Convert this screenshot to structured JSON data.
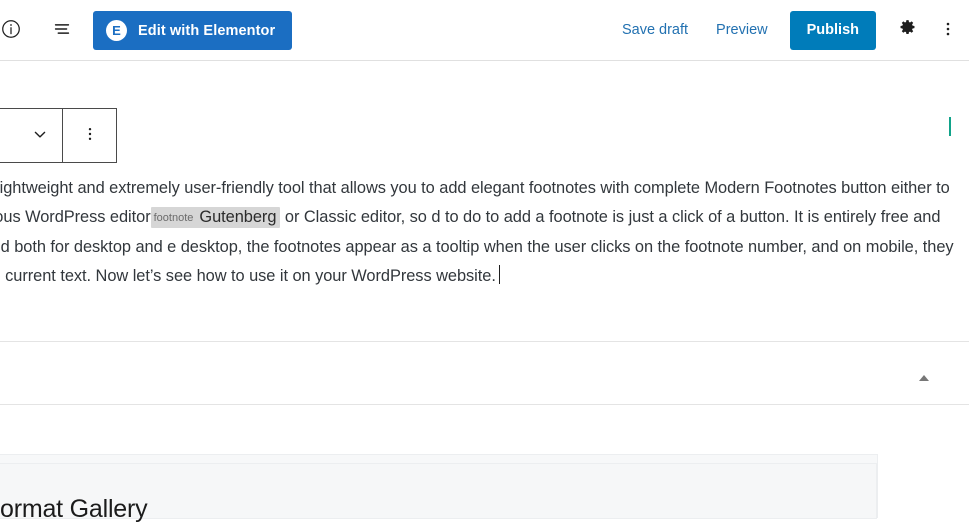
{
  "app": {
    "name": "WordPress Block Editor",
    "accent_blue": "#007cba",
    "elementor_blue": "#1b6ec2",
    "link_blue": "#2271b1",
    "marker_teal": "#11a38a"
  },
  "header": {
    "left_icons": [
      {
        "name": "info-icon",
        "label": "Details"
      },
      {
        "name": "details-icon",
        "label": "Document overview"
      }
    ],
    "elementor_button": {
      "label": "Edit with Elementor",
      "badge_letter": "E"
    },
    "save_draft_label": "Save draft",
    "preview_label": "Preview",
    "publish_label": "Publish",
    "settings_icon": "gear-icon",
    "options_icon": "more-vertical-icon"
  },
  "block_toolbar": {
    "link_icon": "link-icon",
    "chevron_icon": "chevron-down-icon",
    "more_icon": "more-vertical-icon"
  },
  "content": {
    "paragraph": {
      "segment_1": "gin is a lightweight and extremely user-friendly tool that allows you to add elegant footnotes with complete ",
      "segment_2": "Modern Footnotes button either to the famous WordPress editor",
      "footnote_tag": "footnote",
      "footnote_term": "Gutenberg",
      "segment_3": " or Classic editor, so ",
      "segment_4": "d to do to add a footnote is just a click of a button. It is entirely free and optimized both for desktop and ",
      "segment_5": "e desktop, the footnotes appear as a tooltip when the user clicks on the footnote number, and on mobile, they ",
      "segment_6": "elow the current text. Now let’s see how to use it on your WordPress website."
    }
  },
  "collapse": {
    "arrow_icon": "triangle-up-icon"
  },
  "gallery_block": {
    "title": "ormat Gallery"
  }
}
